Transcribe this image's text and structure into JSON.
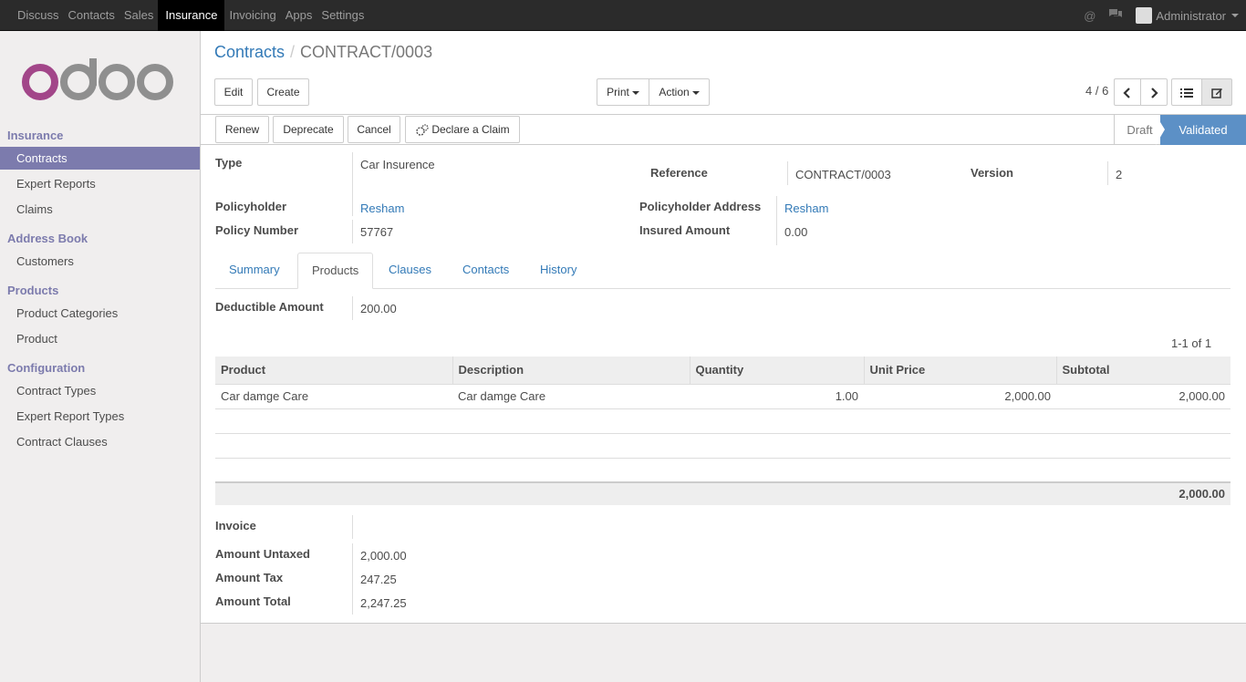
{
  "topbar": {
    "menu": [
      "Discuss",
      "Contacts",
      "Sales",
      "Insurance",
      "Invoicing",
      "Apps",
      "Settings"
    ],
    "active": "Insurance",
    "user": "Administrator"
  },
  "sidebar": {
    "groups": [
      {
        "title": "Insurance",
        "items": [
          "Contracts",
          "Expert Reports",
          "Claims"
        ]
      },
      {
        "title": "Address Book",
        "items": [
          "Customers"
        ]
      },
      {
        "title": "Products",
        "items": [
          "Product Categories",
          "Product"
        ]
      },
      {
        "title": "Configuration",
        "items": [
          "Contract Types",
          "Expert Report Types",
          "Contract Clauses"
        ]
      }
    ],
    "active_item": "Contracts"
  },
  "breadcrumb": {
    "parent": "Contracts",
    "separator": "/",
    "current": "CONTRACT/0003"
  },
  "toolbar": {
    "edit": "Edit",
    "create": "Create",
    "print": "Print",
    "action": "Action",
    "pager": "4 / 6"
  },
  "statusbar": {
    "renew": "Renew",
    "deprecate": "Deprecate",
    "cancel": "Cancel",
    "declare_claim": "Declare a Claim",
    "stage_draft": "Draft",
    "stage_validated": "Validated"
  },
  "form": {
    "type_label": "Type",
    "type_value": "Car Insurence",
    "reference_label": "Reference",
    "reference_value": "CONTRACT/0003",
    "version_label": "Version",
    "version_value": "2",
    "policyholder_label": "Policyholder",
    "policyholder_value": "Resham",
    "policyholder_address_label": "Policyholder Address",
    "policyholder_address_value": "Resham",
    "policy_number_label": "Policy Number",
    "policy_number_value": "57767",
    "insured_amount_label": "Insured Amount",
    "insured_amount_value": "0.00"
  },
  "tabs": [
    "Summary",
    "Products",
    "Clauses",
    "Contacts",
    "History"
  ],
  "products": {
    "deductible_label": "Deductible Amount",
    "deductible_value": "200.00",
    "pager": "1-1 of 1",
    "columns": [
      "Product",
      "Description",
      "Quantity",
      "Unit Price",
      "Subtotal"
    ],
    "rows": [
      [
        "Car damge Care",
        "Car damge Care",
        "1.00",
        "2,000.00",
        "2,000.00"
      ]
    ],
    "total": "2,000.00"
  },
  "invoice": {
    "invoice_label": "Invoice",
    "untaxed_label": "Amount Untaxed",
    "untaxed_value": "2,000.00",
    "tax_label": "Amount Tax",
    "tax_value": "247.25",
    "total_label": "Amount Total",
    "total_value": "2,247.25"
  },
  "colors": {
    "brand": "#7c7bad",
    "link": "#337ab7",
    "stage_active": "#5c90c6",
    "logo_o": "#a24689",
    "logo_doo": "#8f8f8f"
  }
}
